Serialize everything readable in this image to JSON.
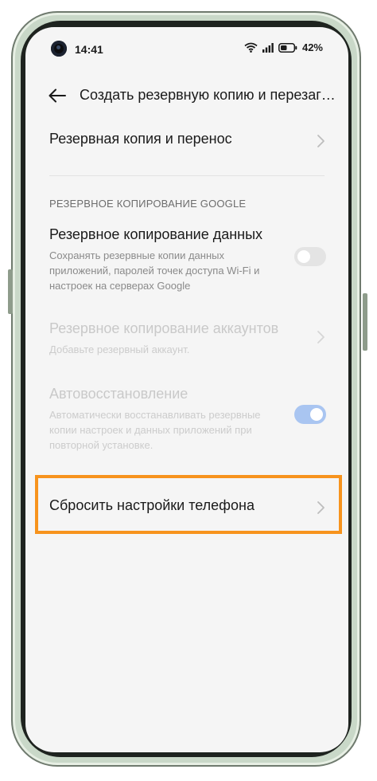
{
  "status_bar": {
    "time": "14:41",
    "battery_percent": "42%",
    "icons": [
      "wifi-icon",
      "signal-icon",
      "battery-icon"
    ]
  },
  "toolbar": {
    "back_icon": "arrow-left-icon",
    "title": "Создать резервную копию и перезагрузить"
  },
  "items": {
    "backup_transfer": {
      "title": "Резервная копия и перенос"
    },
    "google_section": {
      "header": "РЕЗЕРВНОЕ КОПИРОВАНИЕ GOOGLE"
    },
    "data_backup": {
      "title": "Резервное копирование данных",
      "subtitle": "Сохранять резервные копии данных приложений, паролей точек доступа Wi-Fi и настроек на серверах Google",
      "toggle": "off"
    },
    "account_backup": {
      "title": "Резервное копирование аккаунтов",
      "subtitle": "Добавьте резервный аккаунт.",
      "disabled": true
    },
    "auto_restore": {
      "title": "Автовосстановление",
      "subtitle": "Автоматически восстанавливать резервные копии настроек и данных приложений при повторной установке.",
      "toggle": "on",
      "disabled": true
    },
    "reset_phone": {
      "title": "Сбросить настройки телефона"
    }
  },
  "colors": {
    "highlight": "#f7931d",
    "toggle_on_disabled": "#a9c5f1",
    "screen_bg": "#f5f5f5"
  }
}
